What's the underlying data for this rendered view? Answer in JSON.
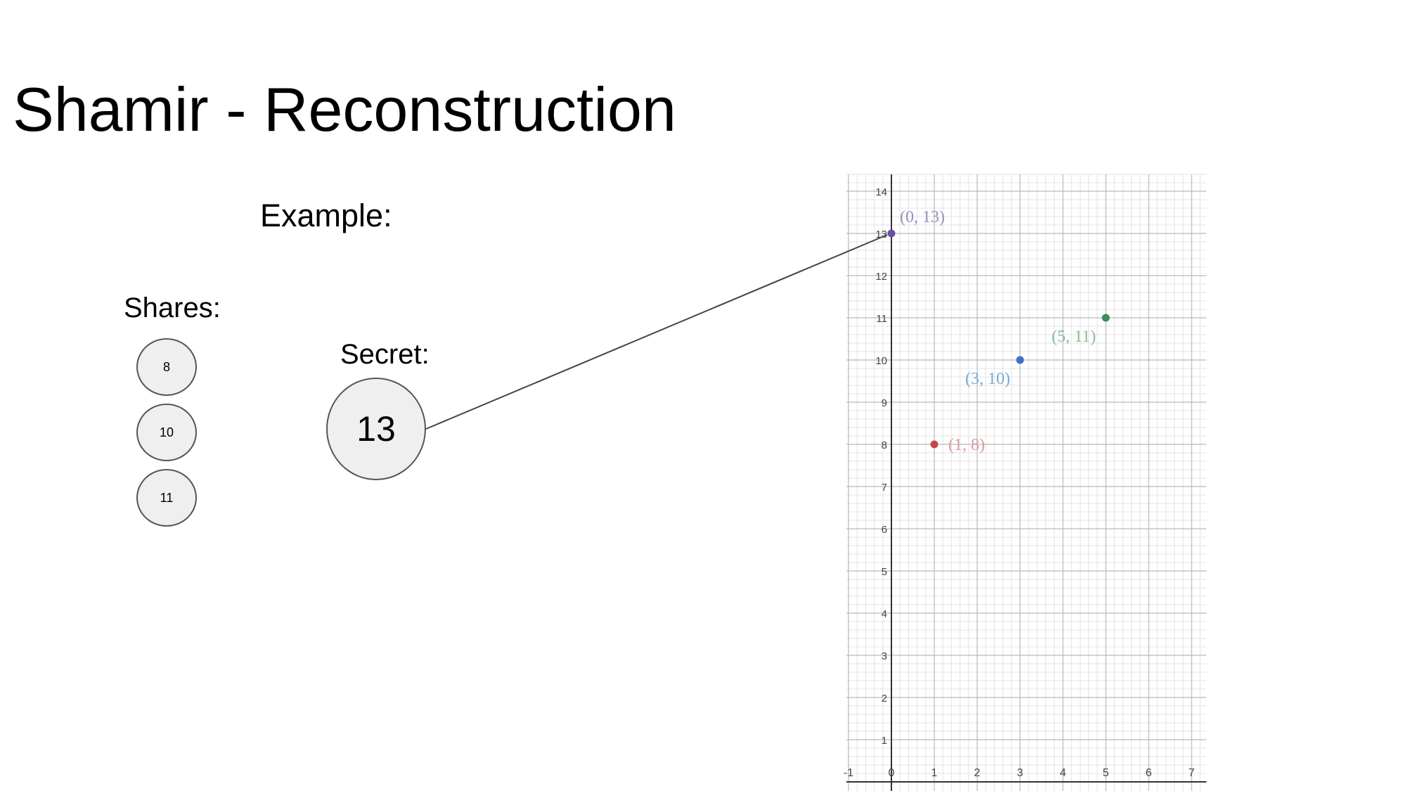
{
  "slide": {
    "title": "Shamir - Reconstruction",
    "example_label": "Example:",
    "shares_label": "Shares:",
    "secret_label": "Secret:",
    "shares": [
      "8",
      "10",
      "11"
    ],
    "secret": "13"
  },
  "colors": {
    "purple": "#6a4ea8",
    "blue": "#3a73c4",
    "green": "#3d8c57",
    "red": "#c94444",
    "purple_label": "#9b8fc0",
    "blue_label": "#7aa7d4",
    "green_label": "#8cbf97",
    "red_label": "#d99a9a"
  },
  "chart_data": {
    "type": "scatter",
    "xlim": [
      -1,
      7
    ],
    "ylim": [
      0,
      14
    ],
    "x_ticks": [
      -1,
      0,
      1,
      2,
      3,
      4,
      5,
      6,
      7
    ],
    "y_ticks": [
      1,
      2,
      3,
      4,
      5,
      6,
      7,
      8,
      9,
      10,
      11,
      12,
      13,
      14
    ],
    "grid": true,
    "points": [
      {
        "x": 0,
        "y": 13,
        "label": "(0, 13)",
        "color": "#6a4ea8",
        "label_color": "#9b8fc0"
      },
      {
        "x": 1,
        "y": 8,
        "label": "(1, 8)",
        "color": "#c94444",
        "label_color": "#d99a9a"
      },
      {
        "x": 3,
        "y": 10,
        "label": "(3, 10)",
        "color": "#3a73c4",
        "label_color": "#7aa7d4"
      },
      {
        "x": 5,
        "y": 11,
        "label": "(5, 11)",
        "color": "#3d8c57",
        "label_color": "#8cbf97"
      }
    ]
  }
}
